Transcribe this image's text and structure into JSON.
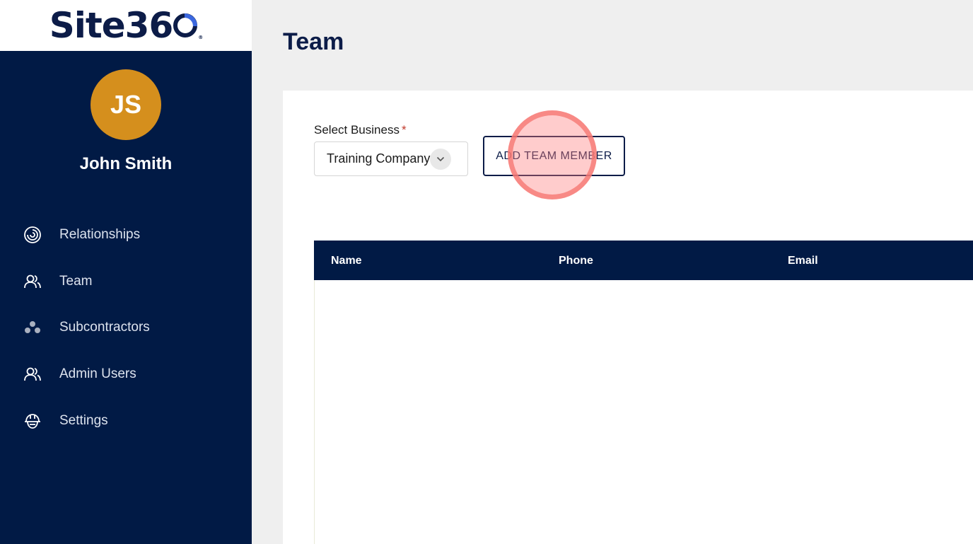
{
  "brand": {
    "logo_text": "Site36",
    "logo_reg": "®"
  },
  "user": {
    "initials": "JS",
    "name": "John Smith"
  },
  "nav": {
    "items": [
      {
        "label": "Relationships",
        "icon": "relationships-icon"
      },
      {
        "label": "Team",
        "icon": "team-icon"
      },
      {
        "label": "Subcontractors",
        "icon": "subcontractors-icon"
      },
      {
        "label": "Admin Users",
        "icon": "admin-users-icon"
      },
      {
        "label": "Settings",
        "icon": "hard-hat-icon"
      }
    ]
  },
  "page": {
    "title": "Team"
  },
  "form": {
    "select_label": "Select Business",
    "required_mark": "*",
    "select_value": "Training Company",
    "add_button": "ADD TEAM MEMBER"
  },
  "table": {
    "columns": [
      "Name",
      "Phone",
      "Email"
    ]
  },
  "colors": {
    "sidebar": "#011a45",
    "avatar": "#d58f1d",
    "brand_navy": "#0c1c48",
    "brand_blue": "#3b68e0"
  }
}
